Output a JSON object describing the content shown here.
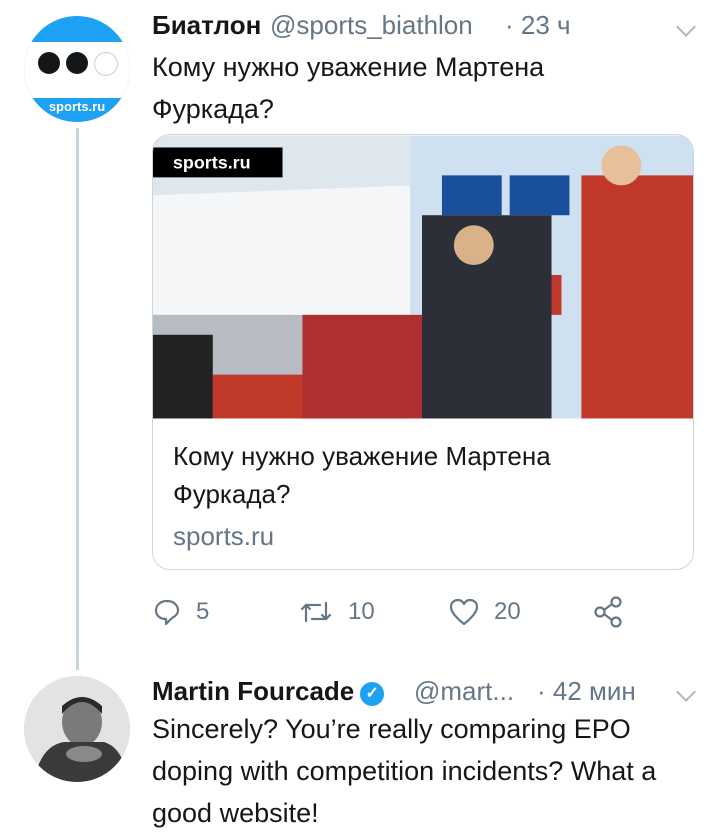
{
  "tweet1": {
    "avatar_label": "sports.ru",
    "name": "Биатлон",
    "handle": "@sports_biathlon",
    "time": "· 23 ч",
    "text": "Кому нужно уважение Мартена Фуркада?",
    "card": {
      "watermark": "sports.ru",
      "title": "Кому нужно уважение Мартена Фуркада?",
      "domain": "sports.ru"
    },
    "actions": {
      "replies": "5",
      "retweets": "10",
      "likes": "20"
    }
  },
  "tweet2": {
    "name": "Martin Fourcade",
    "handle": "@mart...",
    "time": "· 42 мин",
    "text": "Sincerely? You’re really comparing EPO doping with competition incidents? What a good website!"
  },
  "colors": {
    "accent": "#1da1f2",
    "text": "#14171a",
    "secondary": "#657786",
    "border": "#ccd6dd"
  }
}
